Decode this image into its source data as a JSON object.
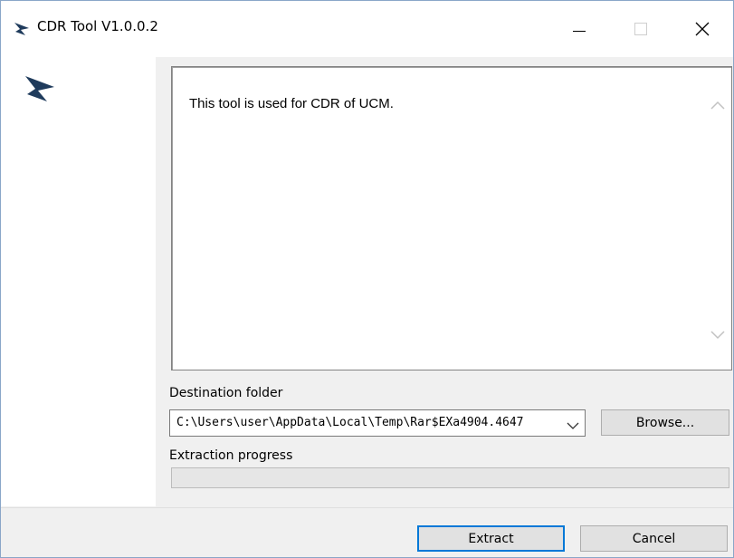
{
  "window": {
    "title": "CDR Tool V1.0.0.2",
    "icon": "grandstream-logo-icon"
  },
  "title_bar": {
    "minimize_icon": "minimize-icon",
    "maximize_icon": "maximize-icon",
    "close_icon": "close-icon"
  },
  "info": {
    "text": "This tool is used for CDR of UCM."
  },
  "destination": {
    "label": "Destination folder",
    "value": "C:\\Users\\user\\AppData\\Local\\Temp\\Rar$EXa4904.4647",
    "browse_label": "Browse..."
  },
  "progress": {
    "label": "Extraction progress",
    "value": 0
  },
  "actions": {
    "extract_label": "Extract",
    "cancel_label": "Cancel"
  },
  "colors": {
    "accent": "#0078d7",
    "logo": "#1f3b5c"
  }
}
